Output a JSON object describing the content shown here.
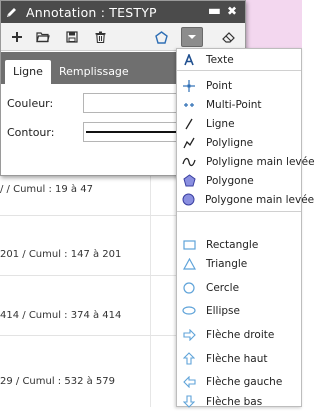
{
  "background": {
    "rows": [
      "/ / Cumul : 19 à 47",
      "201 / Cumul : 147 à 201",
      "414 / Cumul : 374 à 414",
      "29 / Cumul : 532 à 579"
    ]
  },
  "window": {
    "title": "Annotation : TESTYP",
    "minimize": "▬",
    "close": "✖"
  },
  "tabs": {
    "active": "Ligne",
    "inactive": "Remplissage"
  },
  "form": {
    "couleur_label": "Couleur:",
    "contour_label": "Contour:"
  },
  "menu": {
    "items": [
      {
        "label": "Texte",
        "icon": "text-a-icon"
      },
      {
        "label": "Point",
        "icon": "point-icon"
      },
      {
        "label": "Multi-Point",
        "icon": "multipoint-icon"
      },
      {
        "label": "Ligne",
        "icon": "line-icon"
      },
      {
        "label": "Polyligne",
        "icon": "polyline-icon"
      },
      {
        "label": "Polyligne main levée",
        "icon": "freehand-polyline-icon"
      },
      {
        "label": "Polygone",
        "icon": "polygon-icon"
      },
      {
        "label": "Polygone main levée",
        "icon": "freehand-polygon-icon"
      },
      {
        "label": "Rectangle",
        "icon": "rectangle-icon"
      },
      {
        "label": "Triangle",
        "icon": "triangle-icon"
      },
      {
        "label": "Cercle",
        "icon": "circle-icon"
      },
      {
        "label": "Ellipse",
        "icon": "ellipse-icon"
      },
      {
        "label": "Flèche droite",
        "icon": "arrow-right-icon"
      },
      {
        "label": "Flèche haut",
        "icon": "arrow-up-icon"
      },
      {
        "label": "Flèche gauche",
        "icon": "arrow-left-icon"
      },
      {
        "label": "Flèche bas",
        "icon": "arrow-down-icon"
      }
    ]
  },
  "colors": {
    "titlebar": "#4b4b4b",
    "tabbar": "#6f6f6f",
    "icon_blue": "#2f6fb5",
    "pink_area": "#f3d7ef"
  }
}
